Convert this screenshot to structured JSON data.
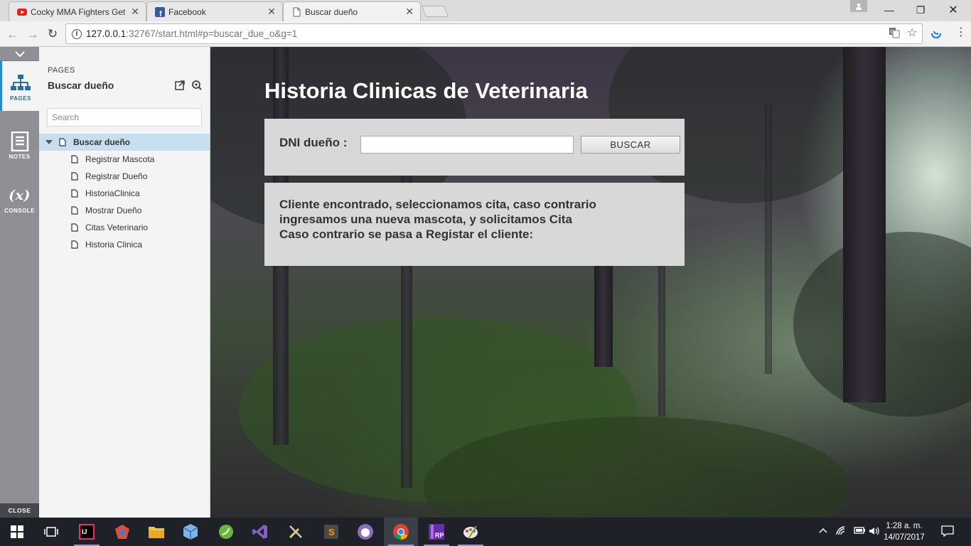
{
  "browser": {
    "tabs": [
      {
        "label": "Cocky MMA Fighters Get",
        "icon": "youtube-icon"
      },
      {
        "label": "Facebook",
        "icon": "facebook-icon"
      },
      {
        "label": "Buscar dueño",
        "icon": "page-icon"
      }
    ],
    "url_host": "127.0.0.1",
    "url_rest": ":32767/start.html#p=buscar_due_o&g=1"
  },
  "rail": {
    "items": [
      {
        "label": "PAGES",
        "icon": "sitemap-icon"
      },
      {
        "label": "NOTES",
        "icon": "notes-icon"
      },
      {
        "label": "CONSOLE",
        "icon": "variable-icon"
      }
    ],
    "close_label": "CLOSE"
  },
  "panel": {
    "caption": "PAGES",
    "current_page": "Buscar dueño",
    "search_placeholder": "Search",
    "tree": {
      "root": "Buscar dueño",
      "children": [
        "Registrar Mascota",
        "Registrar Dueño",
        "HistoriaClinica",
        "Mostrar Dueño",
        "Citas Veterinario",
        "Historia Clinica"
      ]
    }
  },
  "page": {
    "title": "Historia Clinicas de Veterinaria",
    "dni_label": "DNI dueño :",
    "dni_value": "",
    "buscar_label": "BUSCAR",
    "message_lines": [
      "Cliente encontrado, seleccionamos cita, caso contrario",
      "ingresamos una nueva mascota, y solicitamos Cita",
      "Caso contrario se pasa a Registar el cliente:"
    ]
  },
  "taskbar": {
    "time": "1:28 a. m.",
    "date": "14/07/2017"
  },
  "colors": {
    "rail_bg": "#8e9096",
    "panel_bg": "#f4f4f4",
    "tree_selected": "#c8dff0",
    "card_bg": "#d8d8d8",
    "accent": "#2a8ad6",
    "taskbar_bg": "#1e2127"
  }
}
